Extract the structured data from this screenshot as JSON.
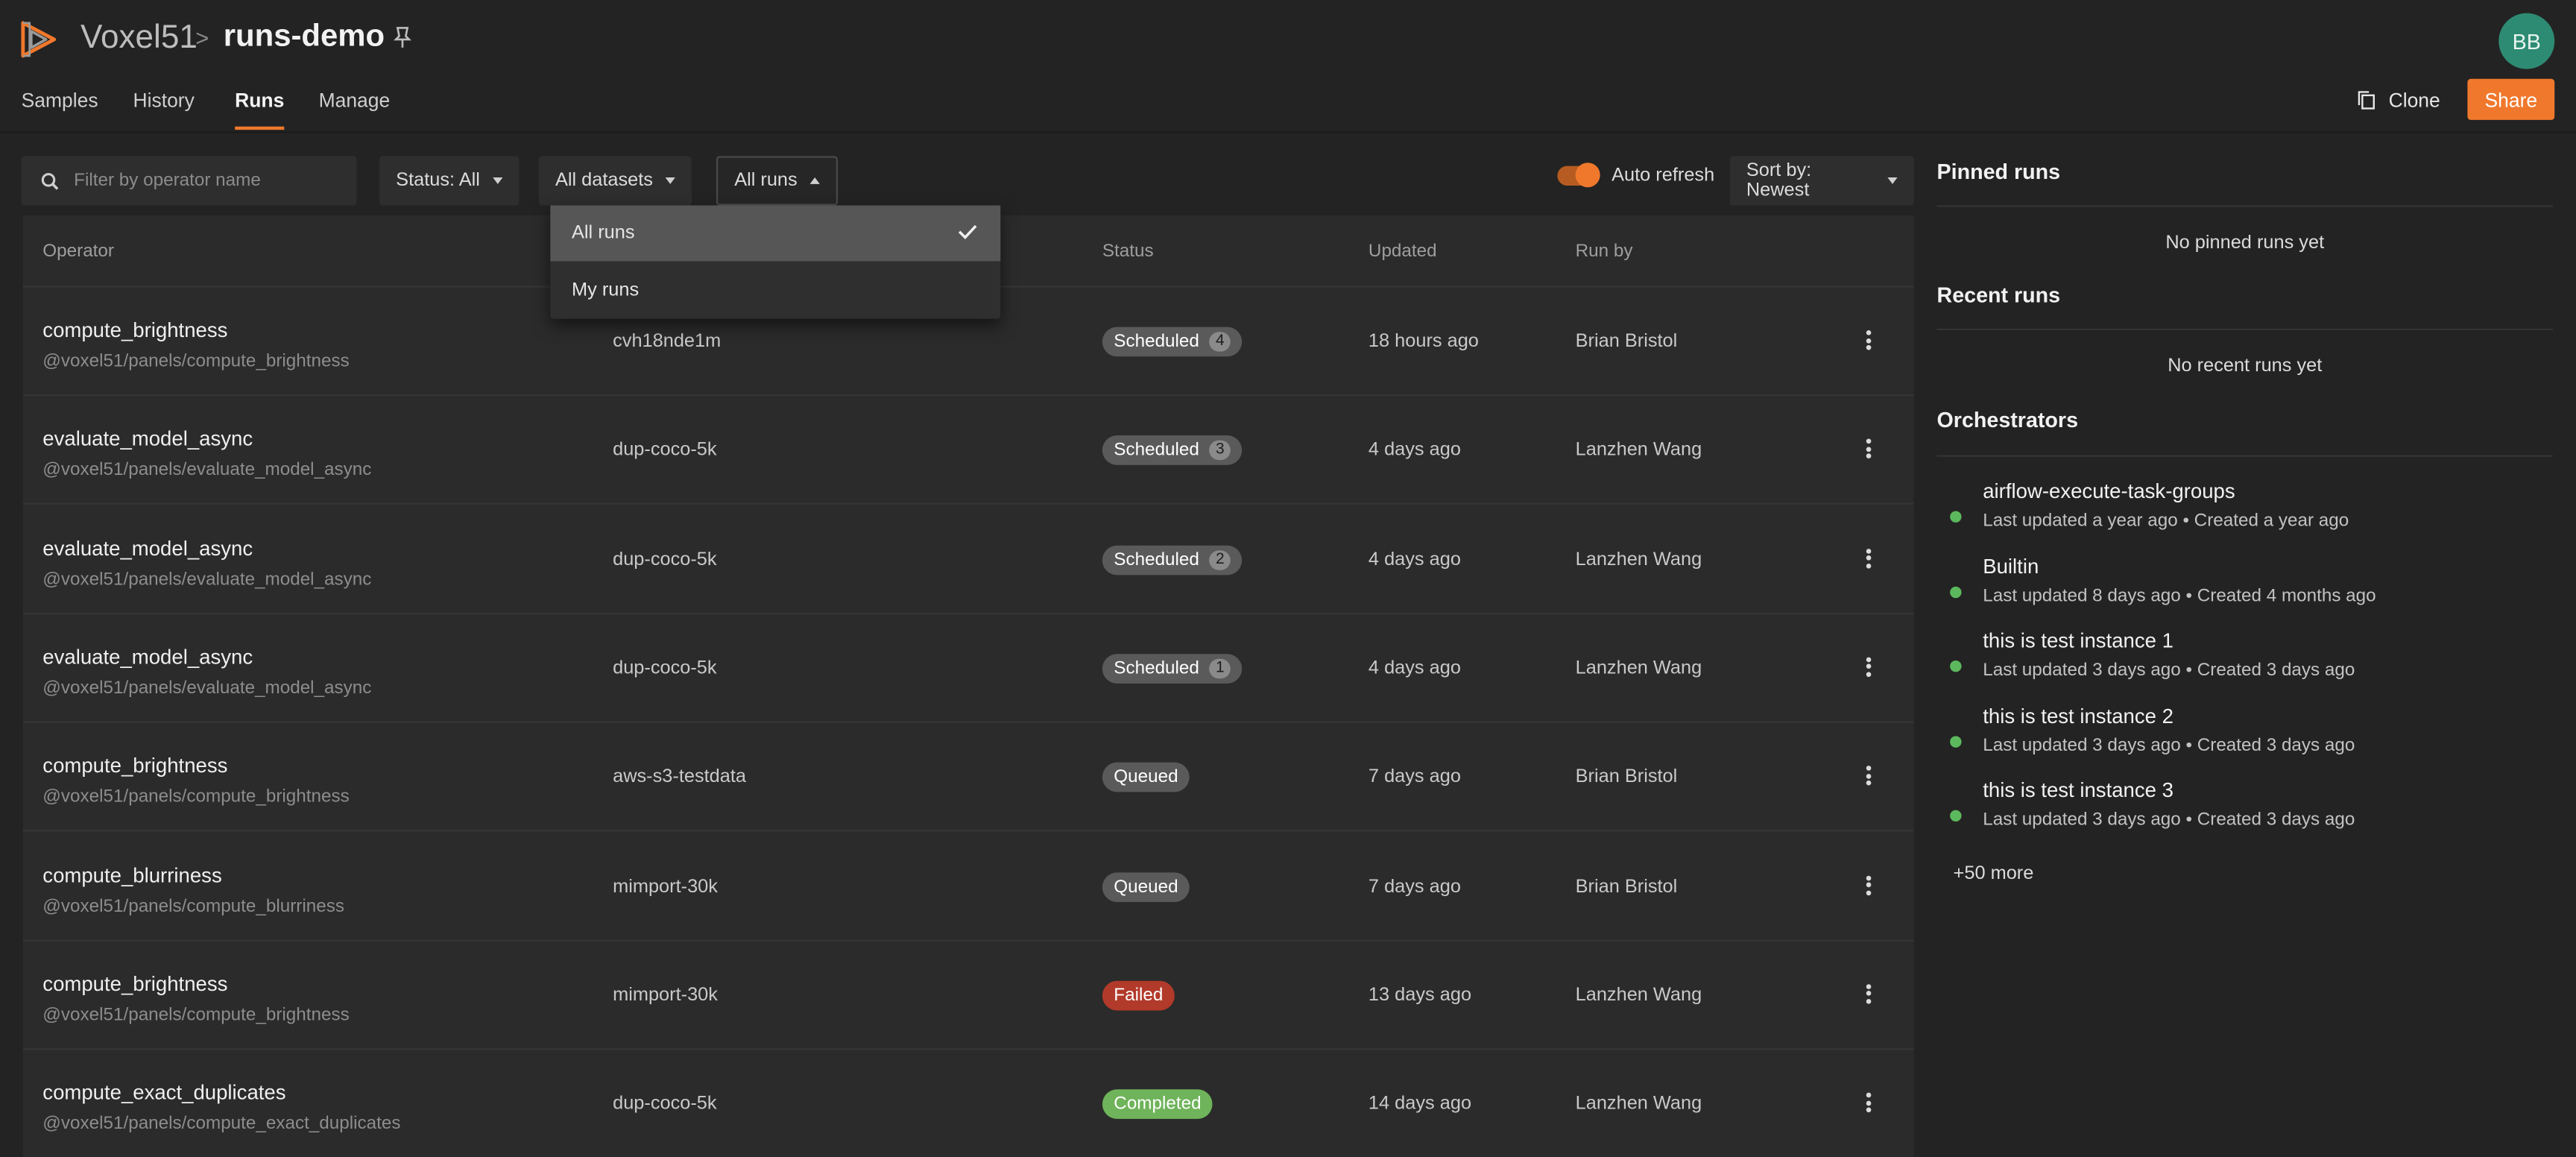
{
  "header": {
    "brand": "Voxel51",
    "separator": ">",
    "dataset": "runs-demo",
    "avatar_initials": "BB",
    "clone_label": "Clone",
    "share_label": "Share"
  },
  "tabs": [
    {
      "label": "Samples"
    },
    {
      "label": "History"
    },
    {
      "label": "Runs",
      "active": true
    },
    {
      "label": "Manage"
    }
  ],
  "filters": {
    "search_placeholder": "Filter by operator name",
    "status_select": "Status: All",
    "datasets_select": "All datasets",
    "runs_select": "All runs",
    "auto_refresh_label": "Auto refresh",
    "auto_refresh_on": true,
    "sort_select": "Sort by: Newest"
  },
  "runs_menu": {
    "items": [
      {
        "label": "All runs",
        "selected": true
      },
      {
        "label": "My runs",
        "selected": false
      }
    ]
  },
  "table": {
    "columns": [
      "Operator",
      "Status",
      "Updated",
      "Run by"
    ],
    "rows": [
      {
        "operator": "compute_brightness",
        "path": "@voxel51/panels/compute_brightness",
        "dataset": "cvh18nde1m",
        "status": "Scheduled",
        "count": "4",
        "updated": "18 hours ago",
        "run_by": "Brian Bristol"
      },
      {
        "operator": "evaluate_model_async",
        "path": "@voxel51/panels/evaluate_model_async",
        "dataset": "dup-coco-5k",
        "status": "Scheduled",
        "count": "3",
        "updated": "4 days ago",
        "run_by": "Lanzhen Wang"
      },
      {
        "operator": "evaluate_model_async",
        "path": "@voxel51/panels/evaluate_model_async",
        "dataset": "dup-coco-5k",
        "status": "Scheduled",
        "count": "2",
        "updated": "4 days ago",
        "run_by": "Lanzhen Wang"
      },
      {
        "operator": "evaluate_model_async",
        "path": "@voxel51/panels/evaluate_model_async",
        "dataset": "dup-coco-5k",
        "status": "Scheduled",
        "count": "1",
        "updated": "4 days ago",
        "run_by": "Lanzhen Wang"
      },
      {
        "operator": "compute_brightness",
        "path": "@voxel51/panels/compute_brightness",
        "dataset": "aws-s3-testdata",
        "status": "Queued",
        "count": "",
        "updated": "7 days ago",
        "run_by": "Brian Bristol"
      },
      {
        "operator": "compute_blurriness",
        "path": "@voxel51/panels/compute_blurriness",
        "dataset": "mimport-30k",
        "status": "Queued",
        "count": "",
        "updated": "7 days ago",
        "run_by": "Brian Bristol"
      },
      {
        "operator": "compute_brightness",
        "path": "@voxel51/panels/compute_brightness",
        "dataset": "mimport-30k",
        "status": "Failed",
        "count": "",
        "updated": "13 days ago",
        "run_by": "Lanzhen Wang"
      },
      {
        "operator": "compute_exact_duplicates",
        "path": "@voxel51/panels/compute_exact_duplicates",
        "dataset": "dup-coco-5k",
        "status": "Completed",
        "count": "",
        "updated": "14 days ago",
        "run_by": "Lanzhen Wang"
      }
    ]
  },
  "status_colors": {
    "Scheduled": "#5a5a5a",
    "Queued": "#5a5a5a",
    "Failed": "#b23a2a",
    "Completed": "#6fb35a"
  },
  "right_panel": {
    "pinned_title": "Pinned runs",
    "pinned_empty": "No pinned runs yet",
    "recent_title": "Recent runs",
    "recent_empty": "No recent runs yet",
    "orchestrators_title": "Orchestrators",
    "orchestrators": [
      {
        "name": "airflow-execute-task-groups",
        "meta": "Last updated a year ago  •  Created a year ago"
      },
      {
        "name": "Builtin",
        "meta": "Last updated 8 days ago  •  Created 4 months ago"
      },
      {
        "name": "this is test instance 1",
        "meta": "Last updated 3 days ago  •  Created 3 days ago"
      },
      {
        "name": "this is test instance 2",
        "meta": "Last updated 3 days ago  •  Created 3 days ago"
      },
      {
        "name": "this is test instance 3",
        "meta": "Last updated 3 days ago  •  Created 3 days ago"
      }
    ],
    "more_label": "+50 more"
  },
  "icons": {
    "logo": "voxel51-logo-icon",
    "pin": "pin-icon",
    "clone": "copy-icon",
    "search": "search-icon",
    "check": "check-icon",
    "kebab": "kebab-menu-icon"
  },
  "colors": {
    "accent": "#f0782c",
    "avatar": "#2e8b73",
    "status_dot": "#5cb85c"
  }
}
